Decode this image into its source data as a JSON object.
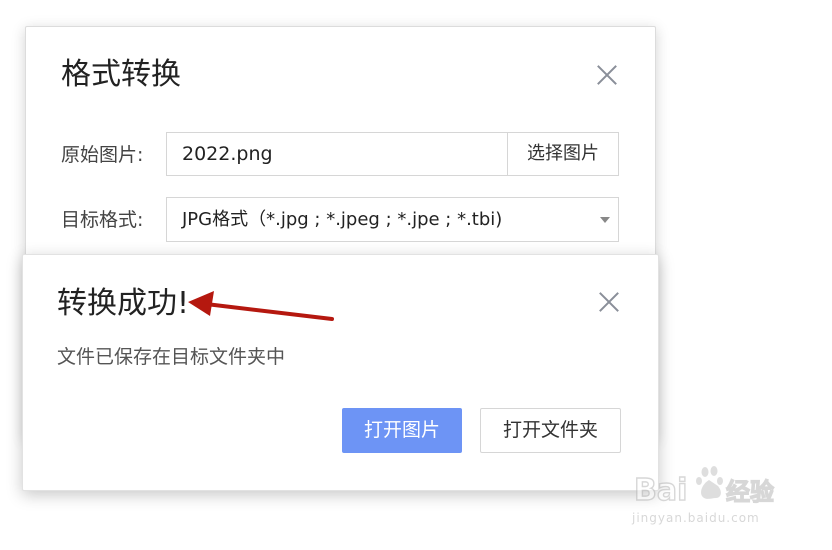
{
  "main_dialog": {
    "title": "格式转换",
    "source_label": "原始图片:",
    "source_value": "2022.png",
    "choose_button": "选择图片",
    "target_label": "目标格式:",
    "target_value": "JPG格式（*.jpg ; *.jpeg ; *.jpe ; *.tbi)",
    "close_icon": "close-icon"
  },
  "success_dialog": {
    "title": "转换成功!",
    "message": "文件已保存在目标文件夹中",
    "open_image_button": "打开图片",
    "open_folder_button": "打开文件夹",
    "close_icon": "close-icon"
  },
  "colors": {
    "primary": "#6d94f5",
    "arrow": "#b5180f"
  },
  "watermark": {
    "logo_text": "Baidu经验",
    "url": "jingyan.baidu.com"
  }
}
